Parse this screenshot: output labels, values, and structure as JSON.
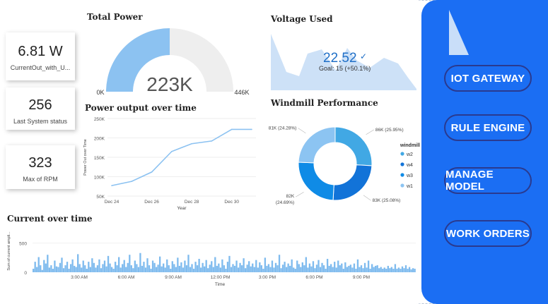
{
  "cards": [
    {
      "value": "6.81 W",
      "label": "CurrentOut_with_U..."
    },
    {
      "value": "256",
      "label": "Last System status"
    },
    {
      "value": "323",
      "label": "Max of RPM"
    }
  ],
  "total_power": {
    "title": "Total Power",
    "value": "223K",
    "min": "0K",
    "max": "446K",
    "fraction": 0.5
  },
  "voltage": {
    "title": "Voltage Used",
    "value": "22.52",
    "goal": "Goal: 15 (+50.1%)"
  },
  "power_over_time": {
    "title": "Power output over time",
    "ylabel": "Power Out over Time",
    "xlabel": "Year"
  },
  "windmill": {
    "title": "Windmill Performance",
    "legend_title": "windmill"
  },
  "current_over_time": {
    "title": "Current over time",
    "ylabel": "Sum of current ampli...",
    "xlabel": "Time"
  },
  "nav": [
    "IOT GATEWAY",
    "RULE ENGINE",
    "MANAGE MODEL",
    "WORK ORDERS"
  ],
  "colors": {
    "accent_blue": "#1b6ef3",
    "light_blue": "#8cc2f1",
    "nav_border": "#2a3a8f"
  },
  "chart_data": [
    {
      "type": "line",
      "title": "Power output over time",
      "xlabel": "Year",
      "ylabel": "Power Out over Time",
      "x_ticks": [
        "Dec 24",
        "Dec 26",
        "Dec 28",
        "Dec 30"
      ],
      "y_ticks": [
        "50K",
        "100K",
        "150K",
        "200K",
        "250K"
      ],
      "ylim": [
        50000,
        250000
      ],
      "x": [
        "Dec 24",
        "Dec 25",
        "Dec 26",
        "Dec 27",
        "Dec 28",
        "Dec 29",
        "Dec 30",
        "Dec 31"
      ],
      "values": [
        77000,
        88000,
        112000,
        165000,
        185000,
        192000,
        222000,
        222000
      ]
    },
    {
      "type": "pie",
      "title": "Windmill Performance",
      "series": [
        {
          "name": "w2",
          "value": 86,
          "label": "86K (25.95%)",
          "color": "#41a8e4"
        },
        {
          "name": "w4",
          "value": 83,
          "label": "83K (25.08%)",
          "color": "#1273d8"
        },
        {
          "name": "w3",
          "value": 82,
          "label": "82K (24.69%)",
          "color": "#0f8be6"
        },
        {
          "name": "w1",
          "value": 81,
          "label": "81K (24.28%)",
          "color": "#8cc4f2"
        }
      ]
    },
    {
      "type": "bar",
      "title": "Current over time",
      "xlabel": "Time",
      "ylabel": "Sum of current ampli...",
      "y_ticks": [
        "0",
        "500"
      ],
      "ylim": [
        0,
        750
      ],
      "x_ticks": [
        "3:00 AM",
        "6:00 AM",
        "9:00 AM",
        "12:00 PM",
        "3:00 PM",
        "6:00 PM",
        "9:00 PM"
      ],
      "values": [
        60,
        180,
        90,
        260,
        120,
        40,
        210,
        150,
        300,
        80,
        120,
        60,
        200,
        100,
        90,
        160,
        250,
        70,
        120,
        180,
        60,
        140,
        220,
        110,
        90,
        310,
        140,
        80,
        200,
        120,
        60,
        180,
        90,
        240,
        160,
        80,
        120,
        220,
        70,
        140,
        200,
        100,
        280,
        150,
        90,
        60,
        180,
        120,
        260,
        80,
        140,
        210,
        90,
        160,
        300,
        120,
        70,
        200,
        140,
        90,
        330,
        110,
        180,
        80,
        240,
        120,
        60,
        200,
        160,
        90,
        130,
        270,
        100,
        150,
        80,
        220,
        120,
        60,
        190,
        140,
        90,
        250,
        110,
        170,
        80,
        200,
        120,
        300,
        90,
        140,
        60,
        180,
        120,
        230,
        80,
        160,
        100,
        210,
        70,
        130,
        190,
        90,
        260,
        110,
        150,
        80,
        220,
        120,
        60,
        180,
        280,
        90,
        140,
        110,
        200,
        80,
        160,
        120,
        240,
        70,
        130,
        190,
        100,
        150,
        90,
        210,
        80,
        170,
        120,
        60,
        250,
        110,
        140,
        90,
        200,
        80,
        160,
        120,
        300,
        70,
        130,
        180,
        90,
        150,
        110,
        220,
        80,
        60,
        200,
        140,
        90,
        170,
        120,
        260,
        80,
        150,
        100,
        190,
        70,
        130,
        210,
        90,
        160,
        120,
        60,
        230,
        110,
        140,
        90,
        180,
        80,
        200,
        120,
        150,
        60,
        170,
        90,
        110,
        130,
        80,
        150,
        60,
        220,
        90,
        120,
        70,
        160,
        80,
        200,
        60,
        140,
        90,
        110,
        120,
        70,
        90,
        60,
        80,
        60,
        110,
        70,
        90,
        60,
        140,
        60,
        80,
        60,
        100,
        70,
        120,
        60,
        90,
        50,
        70,
        60
      ]
    }
  ]
}
